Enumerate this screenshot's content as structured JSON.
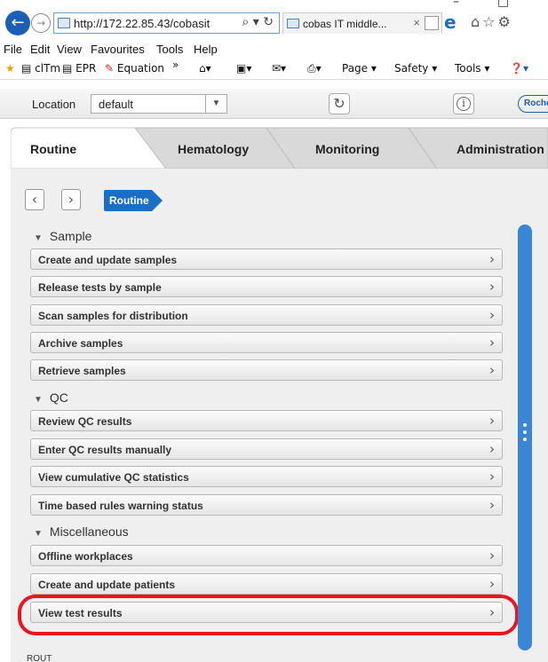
{
  "browser": {
    "window_controls": [
      "–",
      "□",
      "^"
    ],
    "url": "http://172.22.85.43/cobasit",
    "url_controls": "⌕ ▾ ↻",
    "tab_title": "cobas IT middle...",
    "tab_close": "×",
    "toolbar_icons": "⌂☆⚙",
    "menu": [
      "File",
      "Edit",
      "View",
      "Favourites",
      "Tools",
      "Help"
    ],
    "favourites": [
      "clTm",
      "EPR",
      "Equation"
    ],
    "fav_overflow": "»",
    "command_bar": [
      "Page ▾",
      "Safety ▾",
      "Tools ▾"
    ]
  },
  "app": {
    "location_label": "Location",
    "location_value": "default",
    "logo_text": "Roche",
    "tabs": [
      {
        "label": "Routine",
        "active": true
      },
      {
        "label": "Hematology",
        "active": false
      },
      {
        "label": "Monitoring",
        "active": false
      },
      {
        "label": "Administration",
        "active": false
      }
    ],
    "breadcrumb": "Routine",
    "sections": [
      {
        "title": "Sample",
        "items": [
          "Create and update samples",
          "Release tests by sample",
          "Scan samples for distribution",
          "Archive samples",
          "Retrieve samples"
        ]
      },
      {
        "title": "QC",
        "items": [
          "Review QC results",
          "Enter QC results manually",
          "View cumulative QC statistics",
          "Time based rules warning status"
        ]
      },
      {
        "title": "Miscellaneous",
        "items": [
          "Offline workplaces",
          "Create and update patients",
          "View test results"
        ]
      }
    ],
    "footer_code": "ROUT"
  },
  "colors": {
    "accent": "#1a6fc4",
    "highlight": "#e8141f",
    "scrollbar": "#3a86d6"
  }
}
